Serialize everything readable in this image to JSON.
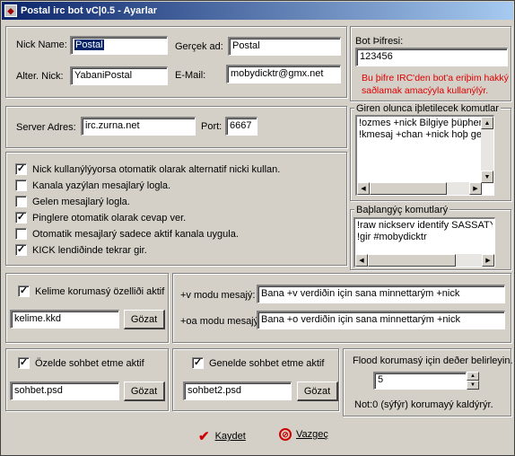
{
  "window": {
    "title": "Postal irc bot vC|0.5 -  Ayarlar",
    "app_icon": "bot-app-icon"
  },
  "identity": {
    "nick_label": "Nick Name:",
    "nick_value": "Postal",
    "real_label": "Gerçek ad:",
    "real_value": "Postal",
    "alt_label": "Alter. Nick:",
    "alt_value": "YabaniPostal",
    "email_label": "E-Mail:",
    "email_value": "mobydicktr@gmx.net"
  },
  "password": {
    "legend": "Bot Þifresi:",
    "value": "123456",
    "note_line1": "Bu þifre IRC'den bot'a eriþim hakký",
    "note_line2": "saðlamak amacýyla kullanýlýr.",
    "note_color": "#e00000"
  },
  "server": {
    "addr_label": "Server Adres:",
    "addr_value": "irc.zurna.net",
    "port_label": "Port:",
    "port_value": "6667"
  },
  "options": [
    {
      "label": "Nick kullanýlýyorsa otomatik olarak alternatif nicki kullan.",
      "checked": true
    },
    {
      "label": "Kanala yazýlan mesajlarý logla.",
      "checked": false
    },
    {
      "label": "Gelen mesajlarý logla.",
      "checked": false
    },
    {
      "label": "Pinglere otomatik olarak cevap ver.",
      "checked": true
    },
    {
      "label": "Otomatik mesajlarý sadece aktif kanala uygula.",
      "checked": false
    },
    {
      "label": "KICK lendiðinde tekrar gir.",
      "checked": true
    }
  ],
  "join_commands": {
    "legend": "Giren olunca iþletilecek komutlar",
    "lines": [
      "!ozmes +nick Bilgiye þüphenin n",
      "!kmesaj +chan +nick hoþ geldin"
    ]
  },
  "startup_commands": {
    "legend": "Baþlangýç komutlarý",
    "lines": [
      "!raw nickserv identify SASSATYU",
      "!gir #mobydicktr"
    ]
  },
  "word_protect": {
    "checkbox_label": "Kelime korumasý özelliði aktif",
    "checked": true,
    "file": "kelime.kkd",
    "browse": "Gözat"
  },
  "modes": {
    "v_label": "+v modu mesajý:",
    "v_value": "Bana +v verdiðin için sana minnettarým +nick",
    "o_label": "+oa modu mesajý:",
    "o_value": "Bana +o verdiðin için sana minnettarým +nick"
  },
  "private_chat": {
    "checkbox_label": "Özelde sohbet etme aktif",
    "checked": true,
    "file": "sohbet.psd",
    "browse": "Gözat"
  },
  "public_chat": {
    "checkbox_label": "Genelde sohbet etme aktif",
    "checked": true,
    "file": "sohbet2.psd",
    "browse": "Gözat"
  },
  "flood": {
    "label": "Flood korumasý için deðer belirleyin.",
    "value": "5",
    "note": "Not:0 (sýfýr) korumayý kaldýrýr."
  },
  "footer": {
    "save": "Kaydet",
    "cancel": "Vazgeç",
    "save_color": "#d00000",
    "cancel_color": "#d00000"
  }
}
